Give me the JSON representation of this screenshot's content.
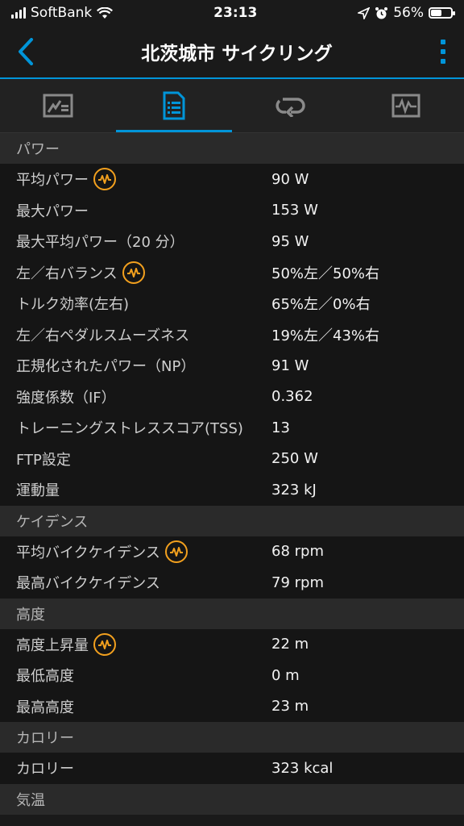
{
  "status_bar": {
    "carrier": "SoftBank",
    "time": "23:13",
    "battery": "56%",
    "battery_level": 0.56
  },
  "header": {
    "title": "北茨城市 サイクリング"
  },
  "tabs": [
    {
      "icon": "overview-chart-icon",
      "active": false
    },
    {
      "icon": "details-list-icon",
      "active": true
    },
    {
      "icon": "laps-loop-icon",
      "active": false
    },
    {
      "icon": "graph-chart-icon",
      "active": false
    }
  ],
  "sections": {
    "power": {
      "title": "パワー",
      "rows": [
        {
          "label": "平均パワー",
          "value": "90 W",
          "graph": true
        },
        {
          "label": "最大パワー",
          "value": "153 W"
        },
        {
          "label": "最大平均パワー（20 分）",
          "value": "95 W"
        },
        {
          "label": "左／右バランス",
          "value": "50%左／50%右",
          "graph": true
        },
        {
          "label": "トルク効率(左右)",
          "value": "65%左／0%右"
        },
        {
          "label": "左／右ペダルスムーズネス",
          "value": "19%左／43%右"
        },
        {
          "label": "正規化されたパワー（NP）",
          "value": "91 W"
        },
        {
          "label": "強度係数（IF）",
          "value": "0.362"
        },
        {
          "label": "トレーニングストレススコア(TSS)",
          "value": "13"
        },
        {
          "label": "FTP設定",
          "value": "250 W"
        },
        {
          "label": "運動量",
          "value": "323 kJ"
        }
      ]
    },
    "cadence": {
      "title": "ケイデンス",
      "rows": [
        {
          "label": "平均バイクケイデンス",
          "value": "68 rpm",
          "graph": true
        },
        {
          "label": "最高バイクケイデンス",
          "value": "79 rpm"
        }
      ]
    },
    "elevation": {
      "title": "高度",
      "rows": [
        {
          "label": "高度上昇量",
          "value": "22 m",
          "graph": true
        },
        {
          "label": "最低高度",
          "value": "0 m"
        },
        {
          "label": "最高高度",
          "value": "23 m"
        }
      ]
    },
    "calories": {
      "title": "カロリー",
      "rows": [
        {
          "label": "カロリー",
          "value": "323 kcal"
        }
      ]
    },
    "temperature": {
      "title": "気温"
    }
  },
  "colors": {
    "accent": "#0095d9",
    "graph_badge": "#f2a01e"
  }
}
